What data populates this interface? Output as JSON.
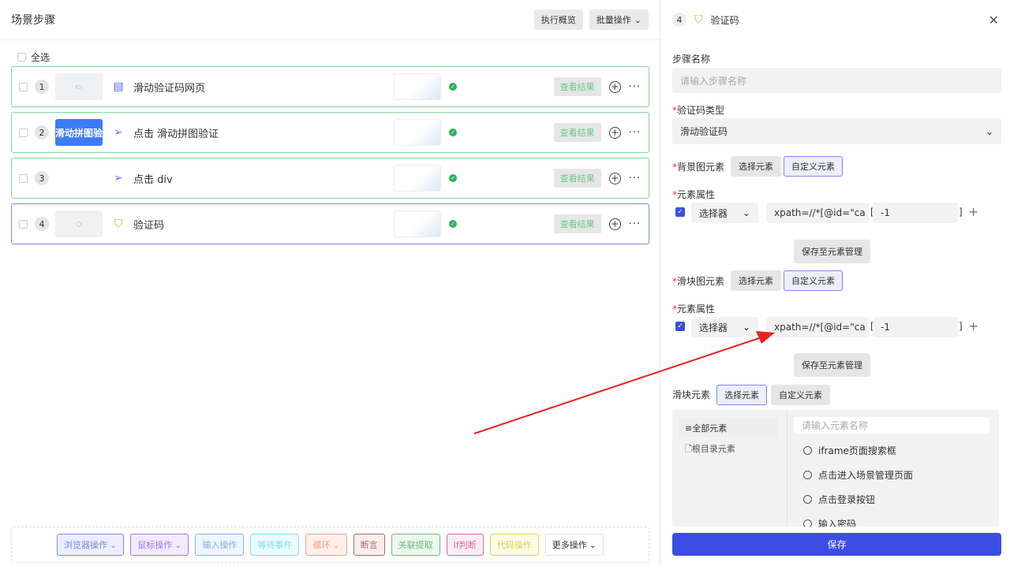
{
  "left": {
    "title": "场景步骤",
    "exec_overview": "执行概览",
    "batch_ops": "批量操作",
    "select_all": "全选",
    "steps": [
      {
        "num": "1",
        "thumb": "▭",
        "icon": "browser-page-icon",
        "name": "滑动验证码网页",
        "result": "查看结果"
      },
      {
        "num": "2",
        "thumb": "滑动拼图验",
        "icon": "click-icon",
        "name": "点击 滑动拼图验证",
        "result": "查看结果"
      },
      {
        "num": "3",
        "thumb": "",
        "icon": "click-icon",
        "name": "点击 div",
        "result": "查看结果"
      },
      {
        "num": "4",
        "thumb": "◇",
        "icon": "shield-check-icon",
        "name": "验证码",
        "result": "查看结果"
      }
    ],
    "ops": [
      "浏览器操作",
      "鼠标操作",
      "输入操作",
      "等待事件",
      "循环",
      "断言",
      "关联提取",
      "If判断",
      "代码操作",
      "更多操作"
    ]
  },
  "right": {
    "num": "4",
    "title": "验证码",
    "step_name_label": "步骤名称",
    "step_name_placeholder": "请输入步骤名称",
    "captcha_type_label": "验证码类型",
    "captcha_type_value": "滑动验证码",
    "bg_label": "背景图元素",
    "select_element": "选择元素",
    "custom_element": "自定义元素",
    "attr_label": "元素属性",
    "selector": "选择器",
    "xpath": "xpath=//*[@id=\"ca",
    "index": "-1",
    "save_to_mgmt": "保存至元素管理",
    "slider_img_label": "滑块图元素",
    "slider_label": "滑块元素",
    "tree_all": "全部元素",
    "tree_root": "根目录元素",
    "search_placeholder": "请输入元素名称",
    "elements": [
      "iframe页面搜索框",
      "点击进入场景管理页面",
      "点击登录按钮",
      "输入密码"
    ],
    "save": "保存"
  },
  "colors": {
    "primary": "#3b4de3",
    "success": "#2fb25a",
    "annotation": "#e8231c"
  }
}
